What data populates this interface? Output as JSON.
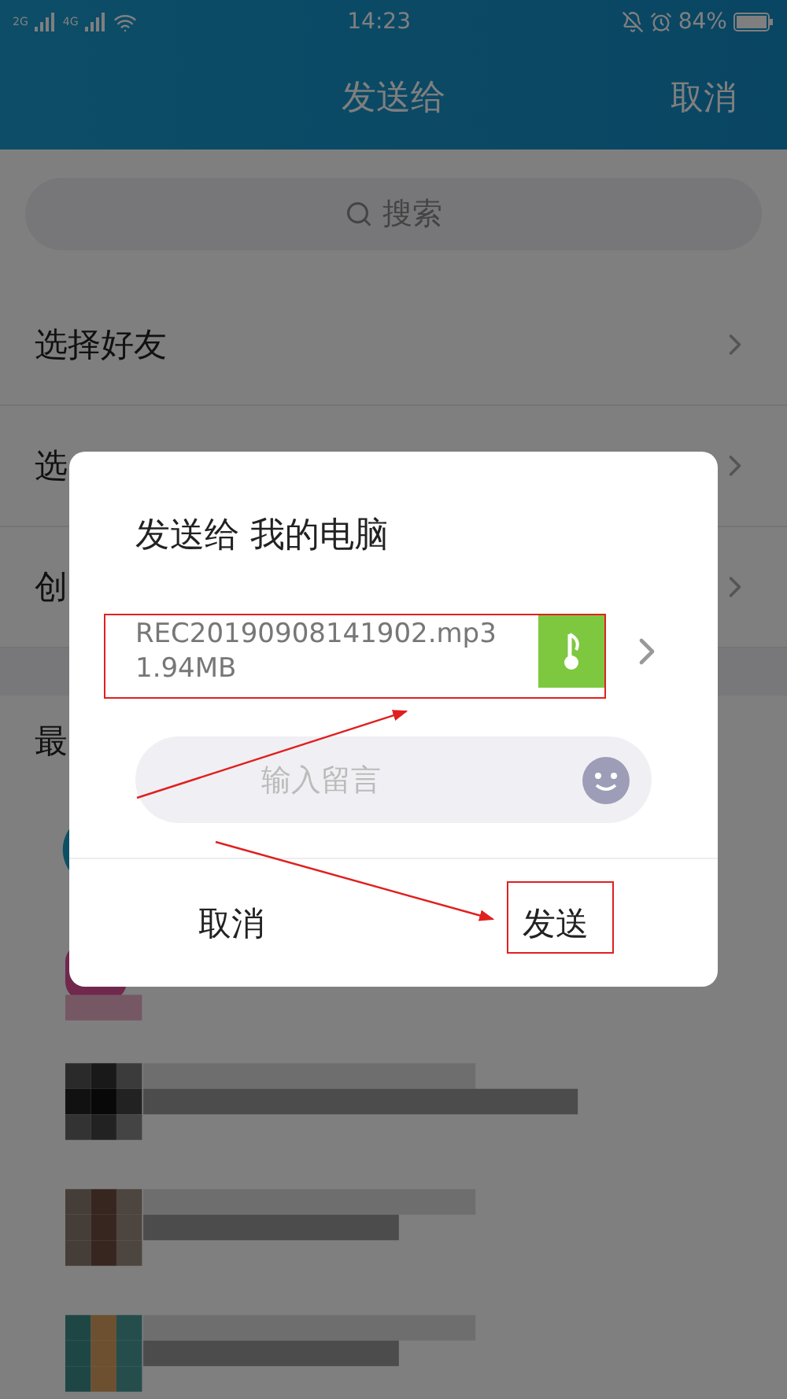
{
  "status_bar": {
    "sim_labels": [
      "2G",
      "4G"
    ],
    "time": "14:23",
    "battery": "84%"
  },
  "header": {
    "title": "发送给",
    "cancel": "取消"
  },
  "search": {
    "placeholder": "搜索"
  },
  "menu_items": [
    {
      "label": "选择好友"
    },
    {
      "label": "选"
    },
    {
      "label": "创"
    }
  ],
  "section_header": "最",
  "dialog": {
    "title": "发送给 我的电脑",
    "file_name": "REC20190908141902.mp3",
    "file_size": "1.94MB",
    "message_placeholder": "输入留言",
    "buttons": [
      "取消",
      "发送"
    ]
  }
}
